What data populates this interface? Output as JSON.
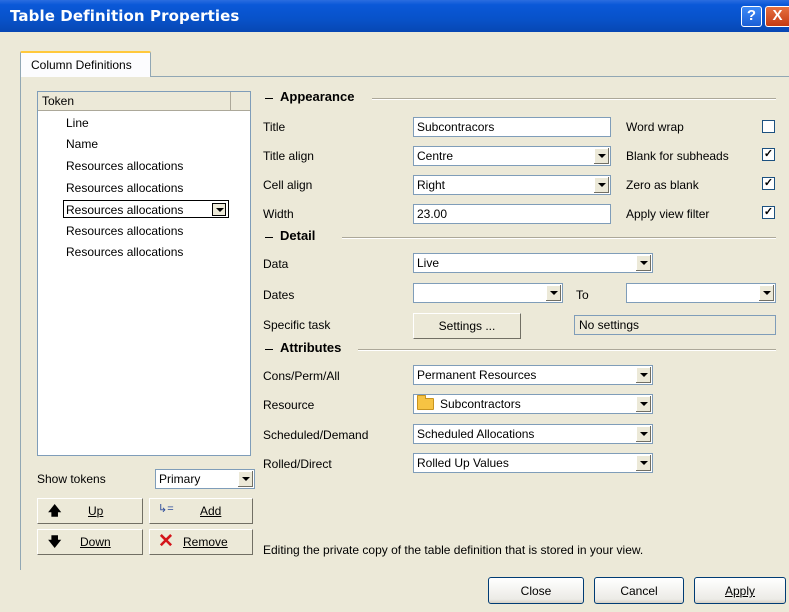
{
  "window": {
    "title": "Table Definition Properties",
    "help": "?",
    "close": "X"
  },
  "tabs": [
    {
      "label": "Column Definitions",
      "active": true
    }
  ],
  "token_list": {
    "header": "Token",
    "items": [
      "Line",
      "Name",
      "Resources allocations",
      "Resources allocations",
      "Resources allocations",
      "Resources allocations",
      "Resources allocations"
    ],
    "selected_index": 4
  },
  "show_tokens": {
    "label": "Show tokens",
    "value": "Primary"
  },
  "buttons": {
    "up": "Up",
    "add": "Add",
    "down": "Down",
    "remove": "Remove",
    "close": "Close",
    "cancel": "Cancel",
    "apply": "Apply",
    "settings": "Settings ..."
  },
  "appearance": {
    "heading": "Appearance",
    "title_label": "Title",
    "title_value": "Subcontracors",
    "title_align_label": "Title align",
    "title_align_value": "Centre",
    "cell_align_label": "Cell align",
    "cell_align_value": "Right",
    "width_label": "Width",
    "width_value": "23.00",
    "word_wrap": {
      "label": "Word wrap",
      "checked": false
    },
    "blank_subheads": {
      "label": "Blank for subheads",
      "checked": true
    },
    "zero_blank": {
      "label": "Zero as blank",
      "checked": true
    },
    "apply_view_filter": {
      "label": "Apply view filter",
      "checked": true
    }
  },
  "detail": {
    "heading": "Detail",
    "data_label": "Data",
    "data_value": "Live",
    "dates_label": "Dates",
    "dates_value": "",
    "to_label": "To",
    "to_value": "",
    "specific_task_label": "Specific task",
    "settings_status": "No settings"
  },
  "attributes": {
    "heading": "Attributes",
    "cons_label": "Cons/Perm/All",
    "cons_value": "Permanent Resources",
    "resource_label": "Resource",
    "resource_value": "Subcontractors",
    "scheduled_label": "Scheduled/Demand",
    "scheduled_value": "Scheduled Allocations",
    "rolled_label": "Rolled/Direct",
    "rolled_value": "Rolled Up Values"
  },
  "status_text": "Editing the private copy of the table definition that is stored in your view.",
  "colors": {
    "titlebar": "#0A58D8",
    "dialog_bg": "#ECE9D8",
    "tab_highlight": "#FFC83C"
  }
}
